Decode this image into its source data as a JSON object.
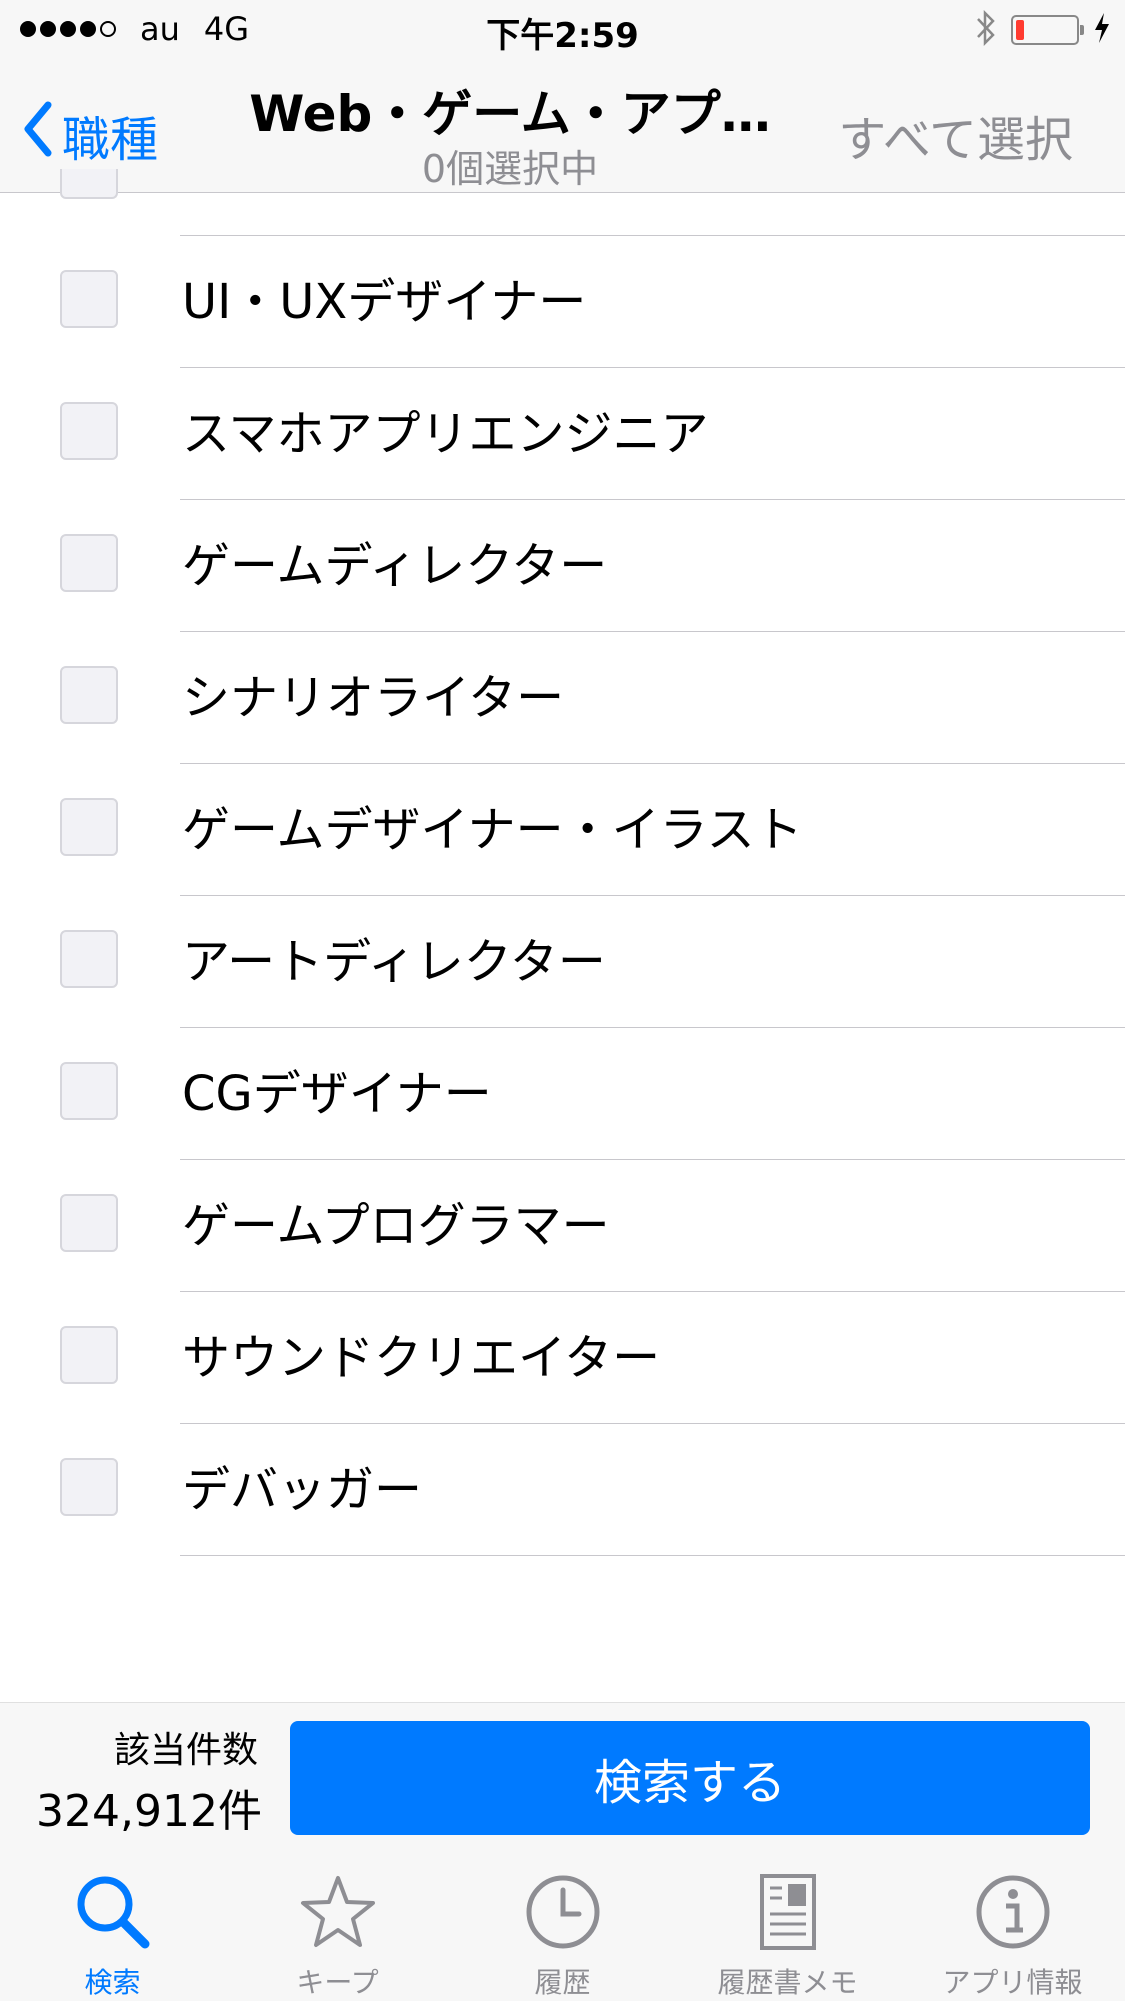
{
  "status_bar": {
    "carrier": "au",
    "network": "4G",
    "time": "下午2:59"
  },
  "nav": {
    "back_label": "職種",
    "title": "Web・ゲーム・アプ…",
    "subtitle": "0個選択中",
    "select_all_label": "すべて選択"
  },
  "list": {
    "items": [
      {
        "label": "UI・UXデザイナー",
        "checked": false
      },
      {
        "label": "スマホアプリエンジニア",
        "checked": false
      },
      {
        "label": "ゲームディレクター",
        "checked": false
      },
      {
        "label": "シナリオライター",
        "checked": false
      },
      {
        "label": "ゲームデザイナー・イラスト",
        "checked": false
      },
      {
        "label": "アートディレクター",
        "checked": false
      },
      {
        "label": "CGデザイナー",
        "checked": false
      },
      {
        "label": "ゲームプログラマー",
        "checked": false
      },
      {
        "label": "サウンドクリエイター",
        "checked": false
      },
      {
        "label": "デバッガー",
        "checked": false
      }
    ]
  },
  "action_bar": {
    "count_label": "該当件数",
    "count_value": "324,912件",
    "search_button_label": "検索する"
  },
  "tab_bar": {
    "tabs": [
      {
        "label": "検索",
        "icon": "search-icon",
        "active": true
      },
      {
        "label": "キープ",
        "icon": "star-icon",
        "active": false
      },
      {
        "label": "履歴",
        "icon": "clock-icon",
        "active": false
      },
      {
        "label": "履歴書メモ",
        "icon": "document-icon",
        "active": false
      },
      {
        "label": "アプリ情報",
        "icon": "info-icon",
        "active": false
      }
    ]
  },
  "colors": {
    "accent": "#007aff",
    "inactive": "#8e8e93",
    "battery_low": "#ff3b30"
  }
}
